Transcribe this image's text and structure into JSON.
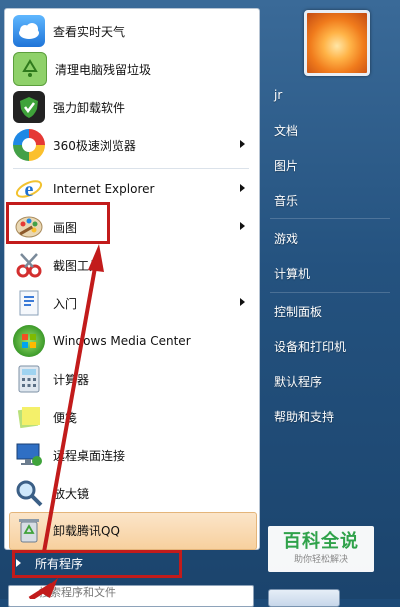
{
  "programs": [
    {
      "label": "查看实时天气",
      "icon": "weather-cloud-icon"
    },
    {
      "label": "清理电脑残留垃圾",
      "icon": "recycle-cleaner-icon"
    },
    {
      "label": "强力卸载软件",
      "icon": "shield-uninstall-icon"
    },
    {
      "label": "360极速浏览器",
      "icon": "360-browser-icon"
    },
    {
      "label": "Internet Explorer",
      "icon": "internet-explorer-icon"
    },
    {
      "label": "画图",
      "icon": "paint-palette-icon"
    },
    {
      "label": "截图工具",
      "icon": "snipping-tool-icon"
    },
    {
      "label": "入门",
      "icon": "getting-started-icon"
    },
    {
      "label": "Windows Media Center",
      "icon": "windows-media-center-icon"
    },
    {
      "label": "计算器",
      "icon": "calculator-icon"
    },
    {
      "label": "便笺",
      "icon": "sticky-notes-icon"
    },
    {
      "label": "远程桌面连接",
      "icon": "remote-desktop-icon"
    },
    {
      "label": "放大镜",
      "icon": "magnifier-icon"
    },
    {
      "label": "卸载腾讯QQ",
      "icon": "recycle-bin-icon"
    }
  ],
  "all_programs": "所有程序",
  "search_placeholder": "搜索程序和文件",
  "right_pane": {
    "user": "jr",
    "items": [
      "文档",
      "图片",
      "音乐",
      "游戏",
      "计算机",
      "控制面板",
      "设备和打印机",
      "默认程序",
      "帮助和支持"
    ]
  },
  "watermark": {
    "title": "百科全说",
    "subtitle": "助你轻松解决"
  },
  "colors": {
    "annotation_red": "#c21b1b",
    "highlight": "#f7d09e"
  }
}
